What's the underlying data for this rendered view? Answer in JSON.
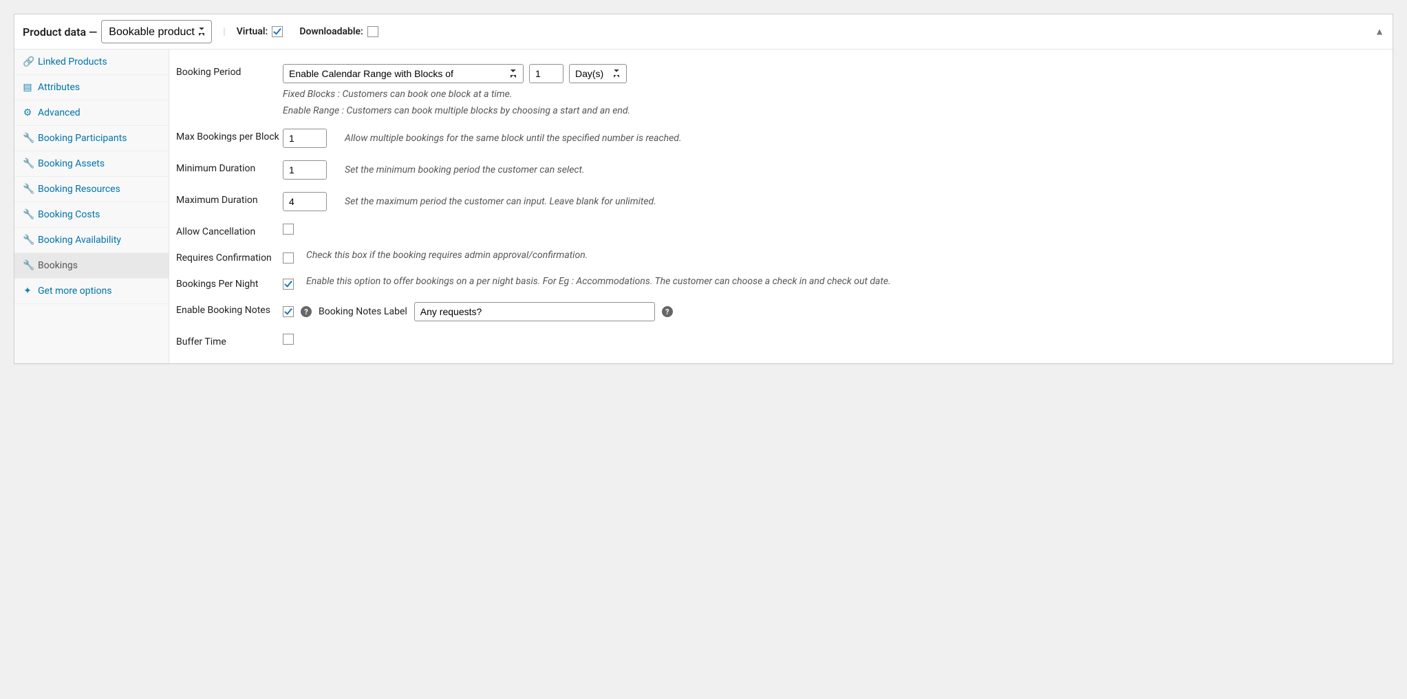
{
  "header": {
    "title": "Product data —",
    "product_type_selected": "Bookable product",
    "virtual_label": "Virtual:",
    "virtual_checked": true,
    "downloadable_label": "Downloadable:",
    "downloadable_checked": false
  },
  "sidebar": {
    "items": [
      {
        "label": "Linked Products",
        "icon": "🔗",
        "icon_name": "link-icon",
        "active": false
      },
      {
        "label": "Attributes",
        "icon": "▤",
        "icon_name": "attributes-icon",
        "active": false
      },
      {
        "label": "Advanced",
        "icon": "⚙",
        "icon_name": "gear-icon",
        "active": false
      },
      {
        "label": "Booking Participants",
        "icon": "🔧",
        "icon_name": "wrench-icon",
        "active": false
      },
      {
        "label": "Booking Assets",
        "icon": "🔧",
        "icon_name": "wrench-icon",
        "active": false
      },
      {
        "label": "Booking Resources",
        "icon": "🔧",
        "icon_name": "wrench-icon",
        "active": false
      },
      {
        "label": "Booking Costs",
        "icon": "🔧",
        "icon_name": "wrench-icon",
        "active": false
      },
      {
        "label": "Booking Availability",
        "icon": "🔧",
        "icon_name": "wrench-icon",
        "active": false
      },
      {
        "label": "Bookings",
        "icon": "🔧",
        "icon_name": "wrench-icon",
        "active": true
      },
      {
        "label": "Get more options",
        "icon": "✦",
        "icon_name": "sparkle-icon",
        "active": false
      }
    ]
  },
  "fields": {
    "booking_period": {
      "label": "Booking Period",
      "range_selected": "Enable Calendar Range with Blocks of",
      "block_value": "1",
      "unit_selected": "Day(s)",
      "help1": "Fixed Blocks : Customers can book one block at a time.",
      "help2": "Enable Range : Customers can book multiple blocks by choosing a start and an end."
    },
    "max_bookings": {
      "label": "Max Bookings per Block",
      "value": "1",
      "help": "Allow multiple bookings for the same block until the specified number is reached."
    },
    "min_duration": {
      "label": "Minimum Duration",
      "value": "1",
      "help": "Set the minimum booking period the customer can select."
    },
    "max_duration": {
      "label": "Maximum Duration",
      "value": "4",
      "help": "Set the maximum period the customer can input. Leave blank for unlimited."
    },
    "allow_cancel": {
      "label": "Allow Cancellation",
      "checked": false
    },
    "requires_conf": {
      "label": "Requires Confirmation",
      "checked": false,
      "help": "Check this box if the booking requires admin approval/confirmation."
    },
    "per_night": {
      "label": "Bookings Per Night",
      "checked": true,
      "help": "Enable this option to offer bookings on a per night basis. For Eg : Accommodations. The customer can choose a check in and check out date."
    },
    "notes": {
      "label": "Enable Booking Notes",
      "checked": true,
      "sub_label": "Booking Notes Label",
      "value": "Any requests?"
    },
    "buffer": {
      "label": "Buffer Time",
      "checked": false
    }
  }
}
